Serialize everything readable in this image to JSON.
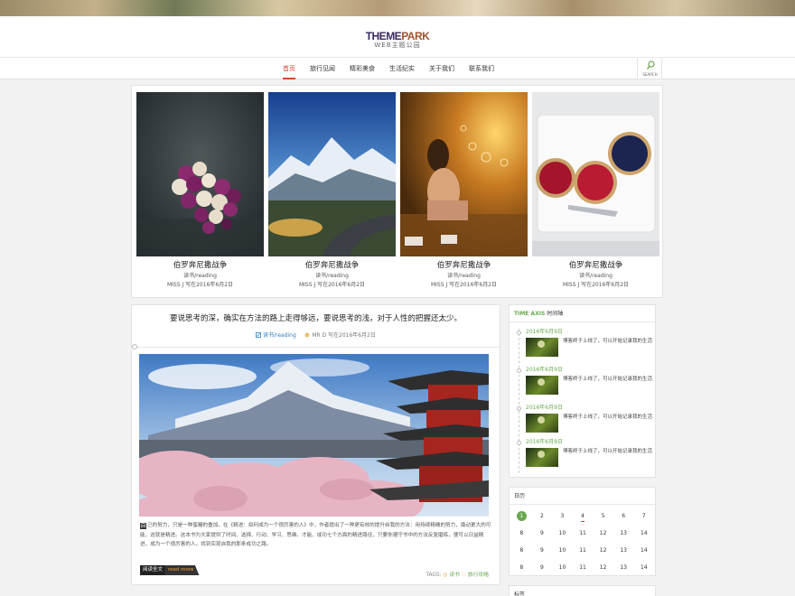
{
  "brand": {
    "logo_part1": "THEME",
    "logo_part2": "PARK",
    "logo_sub": "WEB主题公园"
  },
  "nav": {
    "items": [
      {
        "label": "首页",
        "active": true
      },
      {
        "label": "旅行见闻",
        "active": false
      },
      {
        "label": "精彩美食",
        "active": false
      },
      {
        "label": "生活纪实",
        "active": false
      },
      {
        "label": "关于我们",
        "active": false
      },
      {
        "label": "联系我们",
        "active": false
      }
    ],
    "search_label": "SEARCH",
    "search_icon": "search-icon"
  },
  "featured": [
    {
      "title": "伯罗奔尼撒战争",
      "category": "读书/reading",
      "meta": "MISS J 写在2016年6月2日",
      "image": "heart-flowers-photo"
    },
    {
      "title": "伯罗奔尼撒战争",
      "category": "读书/reading",
      "meta": "MISS J 写在2016年6月2日",
      "image": "mountain-road-photo"
    },
    {
      "title": "伯罗奔尼撒战争",
      "category": "读书/reading",
      "meta": "MISS J 写在2016年6月2日",
      "image": "girl-bubbles-photo"
    },
    {
      "title": "伯罗奔尼撒战争",
      "category": "读书/reading",
      "meta": "MISS J 写在2016年6月2日",
      "image": "berry-tarts-photo"
    }
  ],
  "post": {
    "title": "要说思考的深，确实在方法的路上走得够远，要说思考的浅，对于人性的把握还太少。",
    "category": "读书/reading",
    "meta": "MR D 写在2016年6月2日",
    "dropcap": "自",
    "excerpt": "己的努力，只是一种蜜糖的叠加。在《精进：如何成为一个很厉害的人》中，作者提出了一种更有效的提升自我的方法：用持续精确的努力，撬动更大的可能，这就是精进。这本书为大家提供了时间、选择、行动、学习、思维、才能、成功七个方面的精进路径，只要你遵守书中的方法反复磨练，便可以日益精进，成为一个很厉害的人，找到实现自我的那条成功之路。",
    "read_more_1": "阅读全文",
    "read_more_2": "read more",
    "tags_label": "TAGS:",
    "tags": [
      "读书",
      "旅行攻略"
    ],
    "image": "fuji-pagoda-photo"
  },
  "timeaxis": {
    "title_en": "TIME AXIS",
    "title_cn": "时间轴",
    "items": [
      {
        "date": "2016年6月9日",
        "text": "博客终于上线了，可以开始记录我的生活"
      },
      {
        "date": "2016年6月9日",
        "text": "博客终于上线了，可以开始记录我的生活"
      },
      {
        "date": "2016年6月9日",
        "text": "博客终于上线了，可以开始记录我的生活"
      },
      {
        "date": "2016年6月9日",
        "text": "博客终于上线了，可以开始记录我的生活"
      }
    ]
  },
  "calendar": {
    "title": "日历",
    "rows": [
      [
        "1",
        "2",
        "3",
        "4",
        "5",
        "6",
        "7"
      ],
      [
        "8",
        "9",
        "10",
        "11",
        "12",
        "13",
        "14"
      ],
      [
        "8",
        "9",
        "10",
        "11",
        "12",
        "13",
        "14"
      ],
      [
        "8",
        "9",
        "10",
        "11",
        "12",
        "13",
        "14"
      ]
    ],
    "today": "1",
    "marked": "4"
  },
  "tags_widget": {
    "title": "标签"
  },
  "colors": {
    "accent": "#d9432b",
    "green": "#6aa84f",
    "link": "#2b7fc4"
  }
}
